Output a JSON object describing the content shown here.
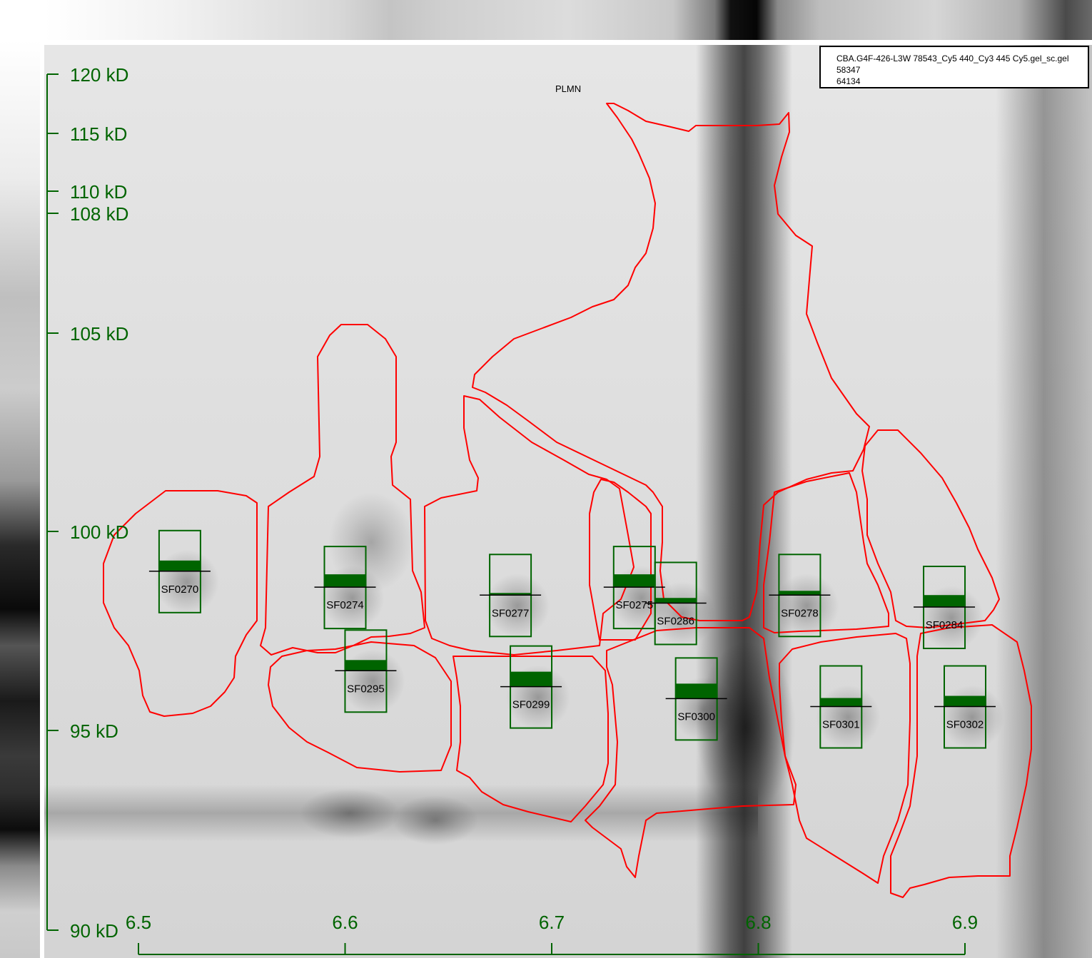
{
  "protein_label": "PLMN",
  "info": {
    "filename": "CBA.G4F-426-L3W 78543_Cy5 440_Cy3 445 Cy5.gel_sc.gel",
    "line2": "58347",
    "line3": "64134"
  },
  "colors": {
    "axis": "#006400",
    "spot_box": "#006400",
    "boundary": "#ff0000",
    "marker": "#000000"
  },
  "y_axis": {
    "unit": "kD",
    "ticks": [
      "120 kD",
      "115 kD",
      "110 kD",
      "108 kD",
      "105 kD",
      "100 kD",
      "95 kD",
      "90 kD"
    ]
  },
  "x_axis": {
    "ticks": [
      "6.5",
      "6.6",
      "6.7",
      "6.8",
      "6.9"
    ]
  },
  "spots": [
    {
      "id": "SF0270",
      "pI": 6.52,
      "mw_kD": 99.0,
      "intensity": 0.25
    },
    {
      "id": "SF0274",
      "pI": 6.6,
      "mw_kD": 98.6,
      "intensity": 0.3
    },
    {
      "id": "SF0277",
      "pI": 6.68,
      "mw_kD": 98.4,
      "intensity": 0.05
    },
    {
      "id": "SF0275",
      "pI": 6.74,
      "mw_kD": 98.6,
      "intensity": 0.3
    },
    {
      "id": "SF0286",
      "pI": 6.76,
      "mw_kD": 98.2,
      "intensity": 0.12
    },
    {
      "id": "SF0278",
      "pI": 6.82,
      "mw_kD": 98.4,
      "intensity": 0.1
    },
    {
      "id": "SF0284",
      "pI": 6.89,
      "mw_kD": 98.1,
      "intensity": 0.28
    },
    {
      "id": "SF0295",
      "pI": 6.61,
      "mw_kD": 96.5,
      "intensity": 0.25
    },
    {
      "id": "SF0299",
      "pI": 6.69,
      "mw_kD": 96.1,
      "intensity": 0.35
    },
    {
      "id": "SF0300",
      "pI": 6.77,
      "mw_kD": 95.8,
      "intensity": 0.35
    },
    {
      "id": "SF0301",
      "pI": 6.84,
      "mw_kD": 95.6,
      "intensity": 0.2
    },
    {
      "id": "SF0302",
      "pI": 6.9,
      "mw_kD": 95.6,
      "intensity": 0.25
    }
  ]
}
